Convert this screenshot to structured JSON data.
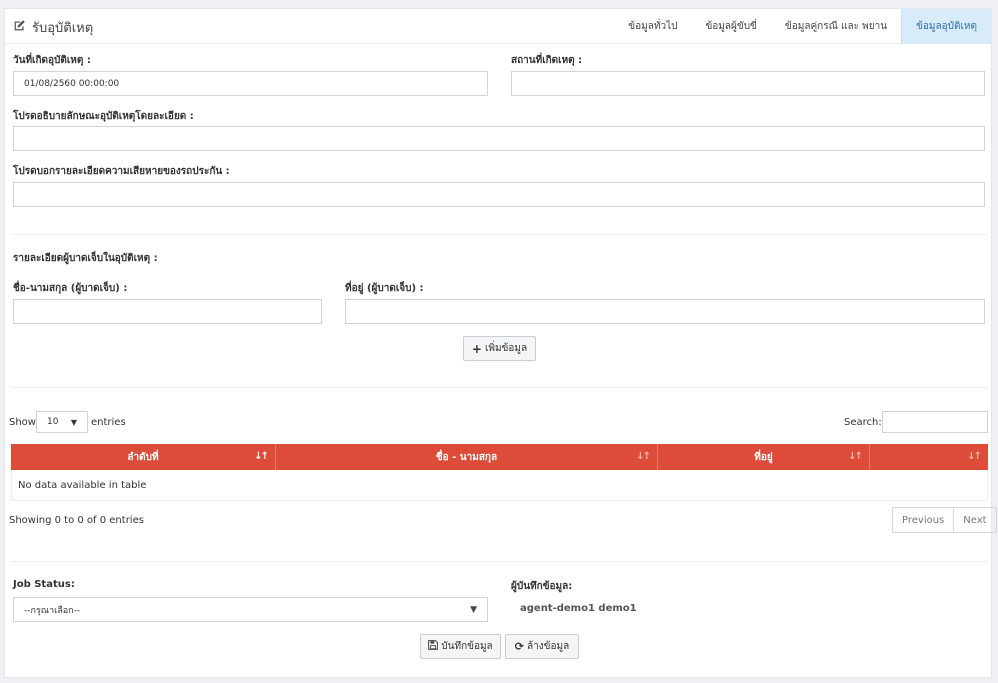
{
  "header": {
    "title": "รับอุบัติเหตุ",
    "title_icon": "edit-icon",
    "tabs": [
      {
        "label": "ข้อมูลทั่วไป"
      },
      {
        "label": "ข้อมูลผู้ขับขี่"
      },
      {
        "label": "ข้อมูลคู่กรณี และ พยาน"
      },
      {
        "label": "ข้อมูลอุบัติเหตุ"
      }
    ],
    "active_tab": "ข้อมูลอุบัติเหตุ"
  },
  "form": {
    "accident_date_label": "วันที่เกิดอุบัติเหตุ :",
    "accident_date_value": "01/08/2560 00:00:00",
    "accident_place_label": "สถานที่เกิดเหตุ :",
    "accident_place_value": "",
    "description_label": "โปรดอธิบายลักษณะอุบัติเหตุโดยละเอียด :",
    "description_value": "",
    "damage_label": "โปรดบอกรายละเอียดความเสียหายของรถประกัน :",
    "damage_value": "",
    "injured_section_label": "รายละเอียดผู้บาดเจ็บในอุบัติเหตุ :",
    "injured_name_label": "ชื่อ-นามสกุล (ผู้บาดเจ็บ) :",
    "injured_name_value": "",
    "injured_address_label": "ที่อยู่ (ผู้บาดเจ็บ) :",
    "injured_address_value": "",
    "add_button": "เพิ่มข้อมูล"
  },
  "table": {
    "show_label": "Show",
    "page_size": "10",
    "entries_label": "entries",
    "search_label": "Search:",
    "search_value": "",
    "columns": [
      "ลำดับที่",
      "ชื่อ - นามสกุล",
      "ที่อยู่",
      ""
    ],
    "empty_message": "No data available in table",
    "info": "Showing 0 to 0 of 0 entries",
    "prev_label": "Previous",
    "next_label": "Next"
  },
  "footer": {
    "job_status_label": "Job Status:",
    "job_status_selected": "--กรุณาเลือก--",
    "recorder_label": "ผู้บันทึกข้อมูล:",
    "recorder_value": "agent-demo1 demo1",
    "save_button": "บันทึกข้อมูล",
    "clear_button": "ล้างข้อมูล"
  },
  "colors": {
    "table_header": "#dd4b39",
    "active_tab_bg": "#d7ebf8",
    "active_tab_text": "#2a6db0"
  }
}
